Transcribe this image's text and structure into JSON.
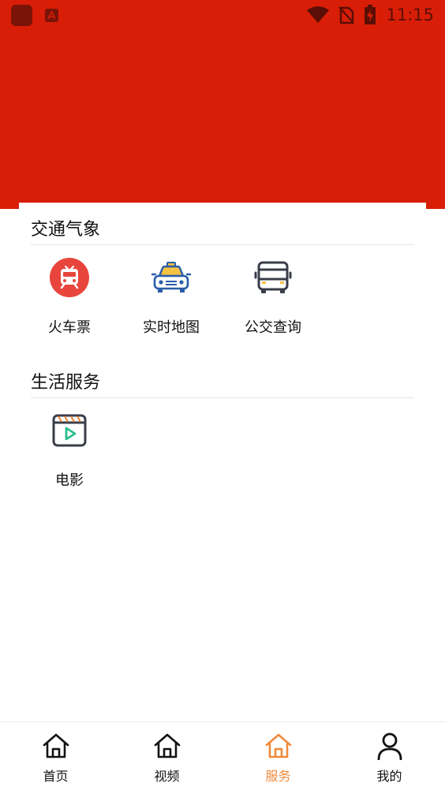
{
  "status_bar": {
    "time": "11:15",
    "icons": [
      "app-icon",
      "text-a-icon",
      "wifi-icon",
      "no-sim-icon",
      "battery-charging-icon"
    ]
  },
  "colors": {
    "header": "#d81e06",
    "active_tab": "#f08a3c",
    "train_icon": "#e8453c",
    "map_icon_yellow": "#f5c342",
    "map_icon_blue": "#2a5da8",
    "icon_dark": "#3a3d4a",
    "movie_accent": "#2bbf8a"
  },
  "sections": [
    {
      "title": "交通气象",
      "items": [
        {
          "label": "火车票",
          "icon": "train-icon"
        },
        {
          "label": "实时地图",
          "icon": "taxi-map-icon"
        },
        {
          "label": "公交查询",
          "icon": "bus-icon"
        }
      ]
    },
    {
      "title": "生活服务",
      "items": [
        {
          "label": "电影",
          "icon": "movie-icon"
        }
      ]
    }
  ],
  "bottom_nav": {
    "active": "服务",
    "items": [
      {
        "label": "首页",
        "icon": "home-icon"
      },
      {
        "label": "视频",
        "icon": "home-icon"
      },
      {
        "label": "服务",
        "icon": "home-icon"
      },
      {
        "label": "我的",
        "icon": "user-icon"
      }
    ]
  }
}
